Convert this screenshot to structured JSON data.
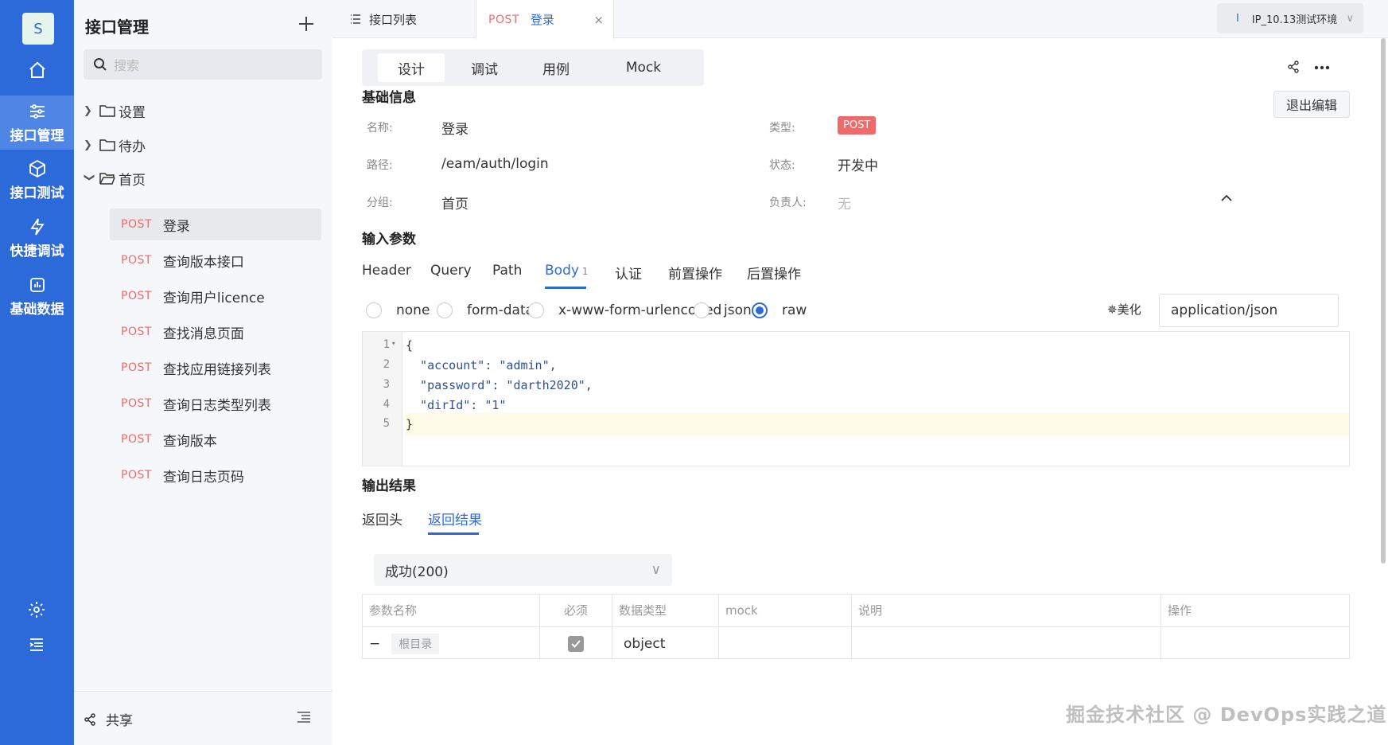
{
  "rail": {
    "avatar": "S",
    "items": [
      {
        "label": "接口管理",
        "icon": "sliders-icon"
      },
      {
        "label": "接口测试",
        "icon": "cube-icon"
      },
      {
        "label": "快捷调试",
        "icon": "lightning-icon"
      },
      {
        "label": "基础数据",
        "icon": "chart-icon"
      }
    ]
  },
  "sidebar": {
    "title": "接口管理",
    "search_placeholder": "搜索",
    "folders": [
      {
        "label": "设置",
        "expanded": false
      },
      {
        "label": "待办",
        "expanded": false
      },
      {
        "label": "首页",
        "expanded": true
      }
    ],
    "apis": [
      {
        "method": "POST",
        "name": "登录"
      },
      {
        "method": "POST",
        "name": "查询版本接口"
      },
      {
        "method": "POST",
        "name": "查询用户licence"
      },
      {
        "method": "POST",
        "name": "查找消息页面"
      },
      {
        "method": "POST",
        "name": "查找应用链接列表"
      },
      {
        "method": "POST",
        "name": "查询日志类型列表"
      },
      {
        "method": "POST",
        "name": "查询版本"
      },
      {
        "method": "POST",
        "name": "查询日志页码"
      }
    ],
    "footer_share": "共享"
  },
  "tabs": {
    "list_label": "接口列表",
    "current_method": "POST",
    "current_name": "登录",
    "close": "×",
    "env_bar": "I",
    "env_label": "IP_10.13测试环境"
  },
  "main": {
    "segments": [
      "设计",
      "调试",
      "用例",
      "Mock"
    ],
    "exit_edit": "退出编辑",
    "basic_title": "基础信息",
    "basic": {
      "name_label": "名称:",
      "name": "登录",
      "path_label": "路径:",
      "path": "/eam/auth/login",
      "group_label": "分组:",
      "group": "首页",
      "type_label": "类型:",
      "type": "POST",
      "status_label": "状态:",
      "status": "开发中",
      "owner_label": "负责人:",
      "owner": "无"
    },
    "input_title": "输入参数",
    "input_tabs": [
      {
        "label": "Header"
      },
      {
        "label": "Query"
      },
      {
        "label": "Path"
      },
      {
        "label": "Body",
        "count": "1"
      },
      {
        "label": "认证"
      },
      {
        "label": "前置操作"
      },
      {
        "label": "后置操作"
      }
    ],
    "body_types": [
      "none",
      "form-data",
      "x-www-form-urlencoded",
      "json",
      "raw"
    ],
    "body_type_selected": "raw",
    "beautify": "美化",
    "content_type": "application/json",
    "code_lines": [
      "{",
      "  \"account\": \"admin\",",
      "  \"password\": \"darth2020\",",
      "  \"dirId\": \"1\"",
      "}"
    ],
    "line_numbers": [
      "1",
      "2",
      "3",
      "4",
      "5"
    ],
    "output_title": "输出结果",
    "output_tabs": [
      "返回头",
      "返回结果"
    ],
    "status_select": "成功(200)",
    "table_headers": [
      "参数名称",
      "必须",
      "数据类型",
      "mock",
      "说明",
      "操作"
    ],
    "table_row": {
      "name": "根目录",
      "required": true,
      "type": "object",
      "collapse": "−"
    }
  },
  "watermark": "掘金技术社区 @ DevOps实践之道",
  "colors": {
    "primary": "#2d6ad9",
    "post": "#f06b6b"
  }
}
